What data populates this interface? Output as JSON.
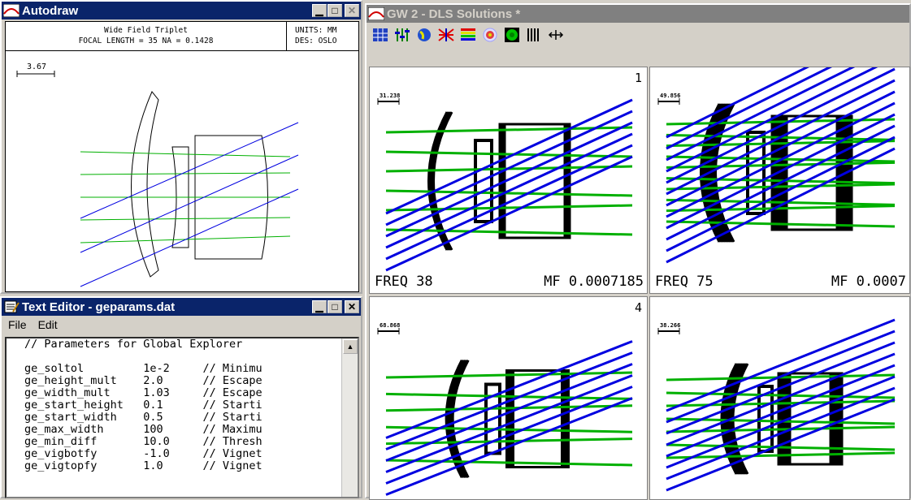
{
  "autodraw": {
    "title": "Autodraw",
    "header": {
      "title": "Wide Field Triplet",
      "spec": "FOCAL LENGTH = 35   NA = 0.1428",
      "units": "UNITS: MM",
      "des": "DES: OSLO"
    },
    "scale_label": "3.67"
  },
  "texteditor": {
    "title": "Text Editor - geparams.dat",
    "menu": [
      "File",
      "Edit"
    ],
    "lines": [
      "// Parameters for Global Explorer",
      "",
      "ge_soltol         1e-2     // Minimu",
      "ge_height_mult    2.0      // Escape",
      "ge_width_mult     1.03     // Escape",
      "ge_start_height   0.1      // Starti",
      "ge_start_width    0.5      // Starti",
      "ge_max_width      100      // Maximu",
      "ge_min_diff       10.0     // Thresh",
      "ge_vigbotfy       -1.0     // Vignet",
      "ge_vigtopfy       1.0      // Vignet"
    ]
  },
  "gw": {
    "title": "GW 2 - DLS Solutions *",
    "toolbar_icons": [
      "grid-icon",
      "sliders-icon",
      "globe-icon",
      "rays-icon",
      "bars-icon",
      "target-icon",
      "circle-icon",
      "stripes-icon",
      "move-icon"
    ],
    "panes": [
      {
        "number": "1",
        "freq": "FREQ 38",
        "mf": "MF 0.0007185",
        "scale": "31.238"
      },
      {
        "number": "",
        "freq": "FREQ 75",
        "mf": "MF 0.0007",
        "scale": "49.856"
      },
      {
        "number": "4",
        "freq": "",
        "mf": "",
        "scale": "68.868"
      },
      {
        "number": "",
        "freq": "",
        "mf": "",
        "scale": "38.266"
      }
    ]
  },
  "colors": {
    "ray_green": "#00b000",
    "ray_blue": "#0000e0",
    "title_active": "#0a246a",
    "title_inactive": "#808080"
  }
}
